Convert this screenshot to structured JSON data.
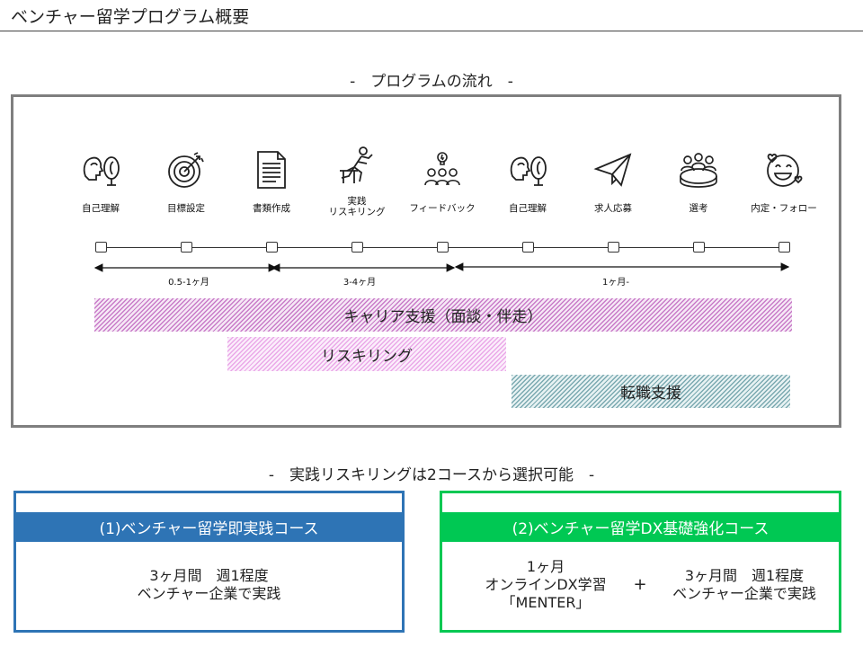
{
  "page": {
    "title": "ベンチャー留学プログラム概要"
  },
  "flow": {
    "heading": "-　プログラムの流れ　-",
    "steps": [
      {
        "label": "自己理解",
        "icon": "head-mirror-icon"
      },
      {
        "label": "目標設定",
        "icon": "target-icon"
      },
      {
        "label": "書類作成",
        "icon": "document-icon"
      },
      {
        "label": "実践\nリスキリング",
        "icon": "runner-hurdle-icon"
      },
      {
        "label": "フィードバック",
        "icon": "team-idea-icon"
      },
      {
        "label": "自己理解",
        "icon": "head-mirror-icon"
      },
      {
        "label": "求人応募",
        "icon": "paper-plane-icon"
      },
      {
        "label": "選考",
        "icon": "meeting-table-icon"
      },
      {
        "label": "内定・フォロー",
        "icon": "smiley-hearts-icon"
      }
    ],
    "phases": [
      {
        "label": "0.5-1ヶ月"
      },
      {
        "label": "3-4ヶ月"
      },
      {
        "label": "1ヶ月-"
      }
    ],
    "bars": {
      "career": "キャリア支援（面談・伴走）",
      "reskill": "リスキリング",
      "job": "転職支援"
    }
  },
  "courses": {
    "heading": "-　実践リスキリングは2コースから選択可能　-",
    "course1": {
      "title": "(1)ベンチャー留学即実践コース",
      "text": "3ヶ月間　週1程度\nベンチャー企業で実践",
      "color": "#2e74b5"
    },
    "course2": {
      "title": "(2)ベンチャー留学DX基礎強化コース",
      "left": "1ヶ月\nオンラインDX学習\n「MENTER」",
      "plus": "+",
      "right": "3ヶ月間　週1程度\nベンチャー企業で実践",
      "color": "#00c853"
    }
  }
}
